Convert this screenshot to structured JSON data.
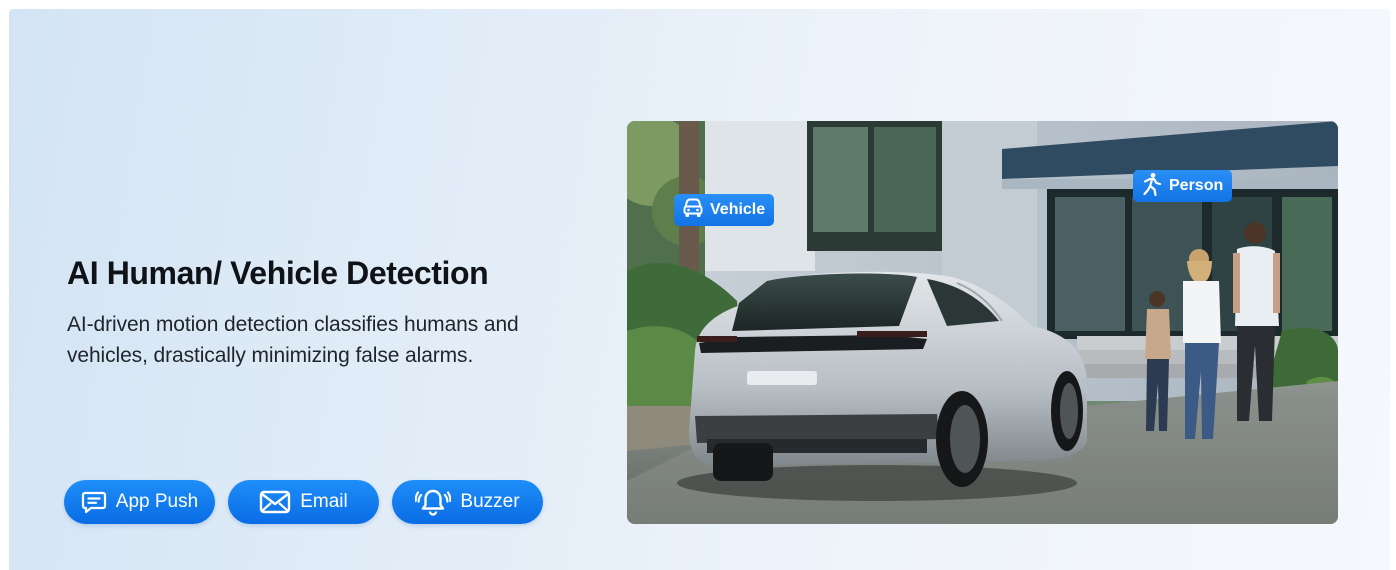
{
  "feature": {
    "title": "AI Human/ Vehicle Detection",
    "description": "AI-driven motion detection classifies humans and vehicles, drastically minimizing false alarms."
  },
  "notifications": [
    {
      "label": "App Push",
      "icon": "chat-bubble-icon"
    },
    {
      "label": "Email",
      "icon": "envelope-icon"
    },
    {
      "label": "Buzzer",
      "icon": "bell-ringing-icon"
    }
  ],
  "photo": {
    "tags": [
      {
        "label": "Vehicle",
        "icon": "car-icon"
      },
      {
        "label": "Person",
        "icon": "walking-person-icon"
      }
    ]
  },
  "colors": {
    "accent": "#0a6ce5",
    "title": "#0f1216"
  }
}
